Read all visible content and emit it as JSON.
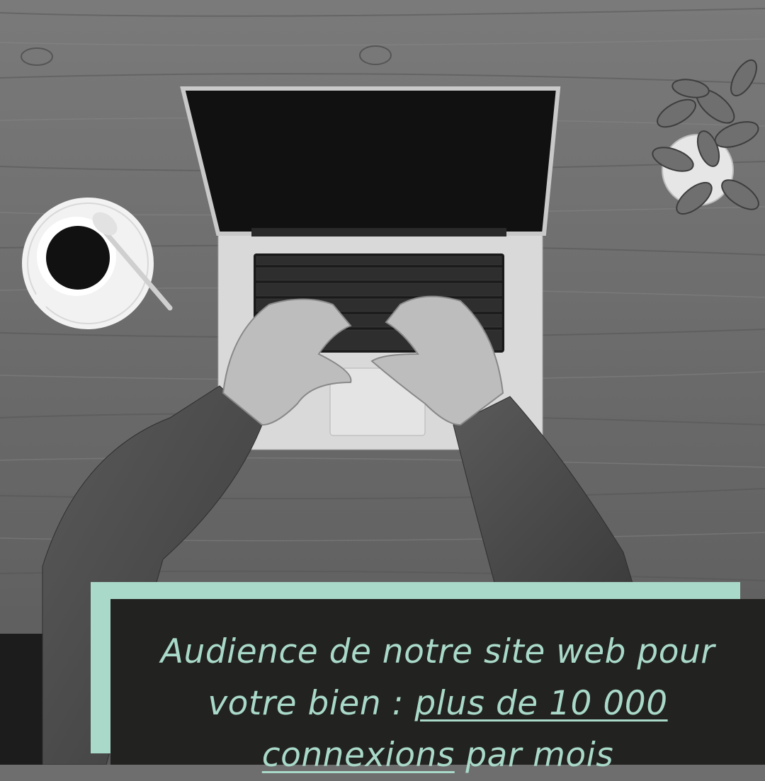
{
  "caption": {
    "part1": "Audience de notre site web pour",
    "part2": "votre bien : ",
    "highlight_line1": "plus de 10 000",
    "highlight_line2": "connexions",
    "part3": " par mois"
  },
  "colors": {
    "accent": "#a9d9c9",
    "panel": "#222220",
    "wood": "#6e6e6e"
  },
  "photo": {
    "description_icon": "laptop-desk-photo"
  }
}
